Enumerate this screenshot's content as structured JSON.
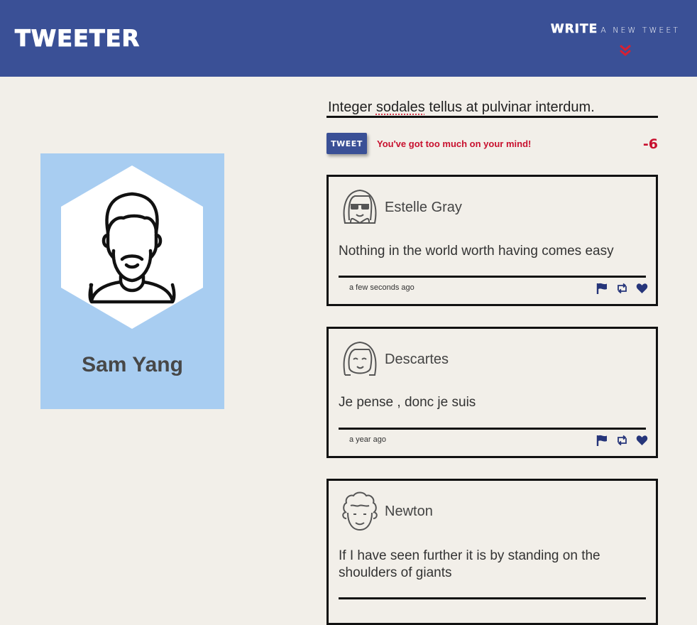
{
  "nav": {
    "brand": "TWEETER",
    "write_bold": "WRITE",
    "write_light": "A NEW TWEET",
    "chevron_icon": "double-chevron-down"
  },
  "profile": {
    "name": "Sam Yang",
    "avatar_icon": "bearded-man-avatar",
    "card_color": "#a8cdf1"
  },
  "compose": {
    "text_start": "Integer ",
    "text_misspelled": "sodales",
    "text_end": " tellus at pulvinar interdum.",
    "button_label": "TWEET",
    "error": "You've got too much on your mind!",
    "counter": "-6"
  },
  "tweets": [
    {
      "author": "Estelle Gray",
      "avatar_icon": "girl-with-sunglasses-avatar",
      "content": "Nothing in the world worth having comes easy",
      "time": "a few seconds ago"
    },
    {
      "author": "Descartes",
      "avatar_icon": "smiling-girl-avatar",
      "content": "Je pense , donc je suis",
      "time": "a year ago"
    },
    {
      "author": "Newton",
      "avatar_icon": "curly-hair-man-avatar",
      "content": "If I have seen further it is by standing on the shoulders of giants",
      "time": ""
    }
  ],
  "actions": {
    "flag_icon": "flag-icon",
    "retweet_icon": "retweet-icon",
    "like_icon": "heart-icon"
  },
  "colors": {
    "nav_bg": "#3a5096",
    "page_bg": "#f2efe9",
    "error": "#c8102e",
    "action_icons": "#26357a"
  }
}
